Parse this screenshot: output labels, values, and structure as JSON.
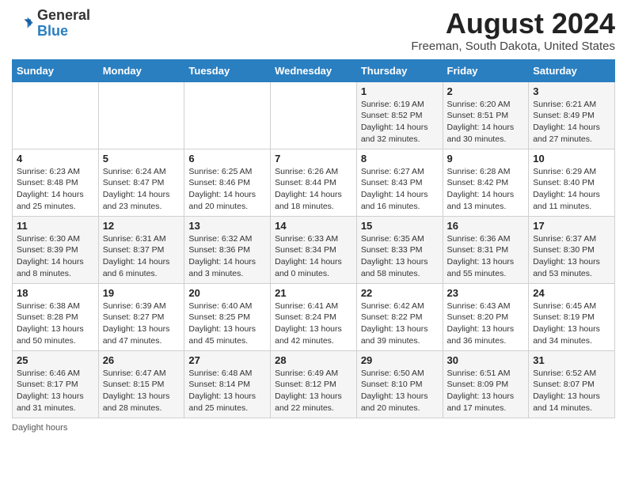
{
  "header": {
    "logo_general": "General",
    "logo_blue": "Blue",
    "month_year": "August 2024",
    "location": "Freeman, South Dakota, United States"
  },
  "days_of_week": [
    "Sunday",
    "Monday",
    "Tuesday",
    "Wednesday",
    "Thursday",
    "Friday",
    "Saturday"
  ],
  "weeks": [
    [
      {
        "day": "",
        "text": ""
      },
      {
        "day": "",
        "text": ""
      },
      {
        "day": "",
        "text": ""
      },
      {
        "day": "",
        "text": ""
      },
      {
        "day": "1",
        "text": "Sunrise: 6:19 AM\nSunset: 8:52 PM\nDaylight: 14 hours and 32 minutes."
      },
      {
        "day": "2",
        "text": "Sunrise: 6:20 AM\nSunset: 8:51 PM\nDaylight: 14 hours and 30 minutes."
      },
      {
        "day": "3",
        "text": "Sunrise: 6:21 AM\nSunset: 8:49 PM\nDaylight: 14 hours and 27 minutes."
      }
    ],
    [
      {
        "day": "4",
        "text": "Sunrise: 6:23 AM\nSunset: 8:48 PM\nDaylight: 14 hours and 25 minutes."
      },
      {
        "day": "5",
        "text": "Sunrise: 6:24 AM\nSunset: 8:47 PM\nDaylight: 14 hours and 23 minutes."
      },
      {
        "day": "6",
        "text": "Sunrise: 6:25 AM\nSunset: 8:46 PM\nDaylight: 14 hours and 20 minutes."
      },
      {
        "day": "7",
        "text": "Sunrise: 6:26 AM\nSunset: 8:44 PM\nDaylight: 14 hours and 18 minutes."
      },
      {
        "day": "8",
        "text": "Sunrise: 6:27 AM\nSunset: 8:43 PM\nDaylight: 14 hours and 16 minutes."
      },
      {
        "day": "9",
        "text": "Sunrise: 6:28 AM\nSunset: 8:42 PM\nDaylight: 14 hours and 13 minutes."
      },
      {
        "day": "10",
        "text": "Sunrise: 6:29 AM\nSunset: 8:40 PM\nDaylight: 14 hours and 11 minutes."
      }
    ],
    [
      {
        "day": "11",
        "text": "Sunrise: 6:30 AM\nSunset: 8:39 PM\nDaylight: 14 hours and 8 minutes."
      },
      {
        "day": "12",
        "text": "Sunrise: 6:31 AM\nSunset: 8:37 PM\nDaylight: 14 hours and 6 minutes."
      },
      {
        "day": "13",
        "text": "Sunrise: 6:32 AM\nSunset: 8:36 PM\nDaylight: 14 hours and 3 minutes."
      },
      {
        "day": "14",
        "text": "Sunrise: 6:33 AM\nSunset: 8:34 PM\nDaylight: 14 hours and 0 minutes."
      },
      {
        "day": "15",
        "text": "Sunrise: 6:35 AM\nSunset: 8:33 PM\nDaylight: 13 hours and 58 minutes."
      },
      {
        "day": "16",
        "text": "Sunrise: 6:36 AM\nSunset: 8:31 PM\nDaylight: 13 hours and 55 minutes."
      },
      {
        "day": "17",
        "text": "Sunrise: 6:37 AM\nSunset: 8:30 PM\nDaylight: 13 hours and 53 minutes."
      }
    ],
    [
      {
        "day": "18",
        "text": "Sunrise: 6:38 AM\nSunset: 8:28 PM\nDaylight: 13 hours and 50 minutes."
      },
      {
        "day": "19",
        "text": "Sunrise: 6:39 AM\nSunset: 8:27 PM\nDaylight: 13 hours and 47 minutes."
      },
      {
        "day": "20",
        "text": "Sunrise: 6:40 AM\nSunset: 8:25 PM\nDaylight: 13 hours and 45 minutes."
      },
      {
        "day": "21",
        "text": "Sunrise: 6:41 AM\nSunset: 8:24 PM\nDaylight: 13 hours and 42 minutes."
      },
      {
        "day": "22",
        "text": "Sunrise: 6:42 AM\nSunset: 8:22 PM\nDaylight: 13 hours and 39 minutes."
      },
      {
        "day": "23",
        "text": "Sunrise: 6:43 AM\nSunset: 8:20 PM\nDaylight: 13 hours and 36 minutes."
      },
      {
        "day": "24",
        "text": "Sunrise: 6:45 AM\nSunset: 8:19 PM\nDaylight: 13 hours and 34 minutes."
      }
    ],
    [
      {
        "day": "25",
        "text": "Sunrise: 6:46 AM\nSunset: 8:17 PM\nDaylight: 13 hours and 31 minutes."
      },
      {
        "day": "26",
        "text": "Sunrise: 6:47 AM\nSunset: 8:15 PM\nDaylight: 13 hours and 28 minutes."
      },
      {
        "day": "27",
        "text": "Sunrise: 6:48 AM\nSunset: 8:14 PM\nDaylight: 13 hours and 25 minutes."
      },
      {
        "day": "28",
        "text": "Sunrise: 6:49 AM\nSunset: 8:12 PM\nDaylight: 13 hours and 22 minutes."
      },
      {
        "day": "29",
        "text": "Sunrise: 6:50 AM\nSunset: 8:10 PM\nDaylight: 13 hours and 20 minutes."
      },
      {
        "day": "30",
        "text": "Sunrise: 6:51 AM\nSunset: 8:09 PM\nDaylight: 13 hours and 17 minutes."
      },
      {
        "day": "31",
        "text": "Sunrise: 6:52 AM\nSunset: 8:07 PM\nDaylight: 13 hours and 14 minutes."
      }
    ]
  ],
  "footer": {
    "daylight_hours": "Daylight hours"
  }
}
